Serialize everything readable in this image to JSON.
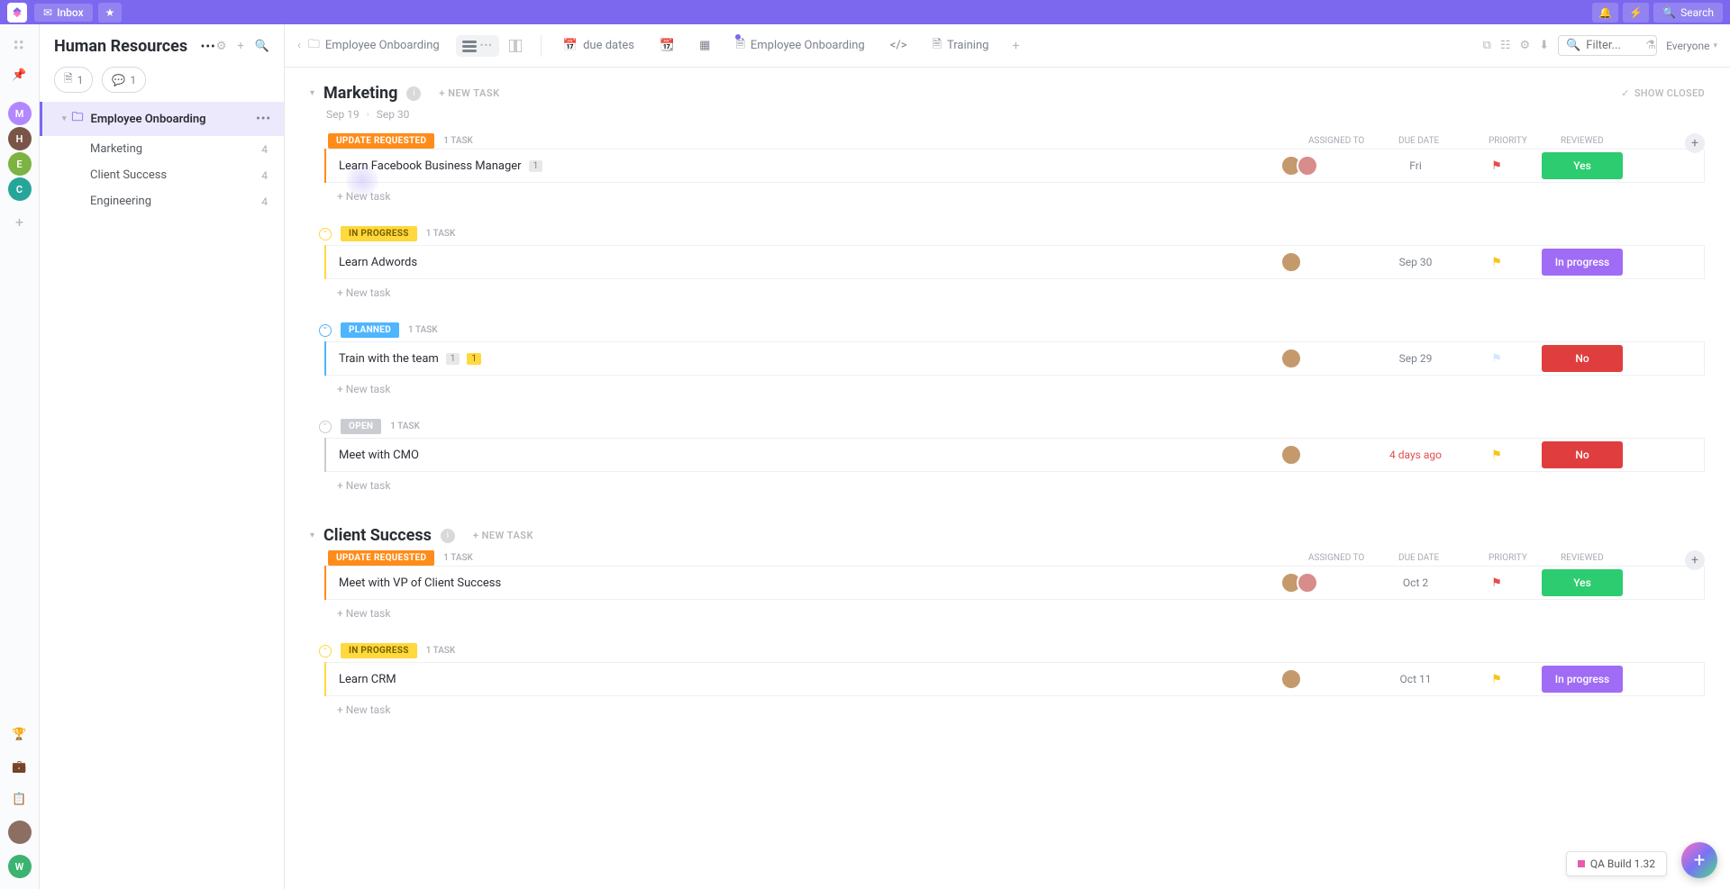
{
  "topbar": {
    "inbox": "Inbox",
    "search": "Search"
  },
  "rail": {
    "spaces": [
      {
        "letter": "M",
        "color": "#b388ff"
      },
      {
        "letter": "H",
        "color": "#795548"
      },
      {
        "letter": "E",
        "color": "#7cb342"
      },
      {
        "letter": "C",
        "color": "#26a69a"
      }
    ]
  },
  "sidebar": {
    "title": "Human Resources",
    "doc_count": "1",
    "comment_count": "1",
    "active_item": "Employee Onboarding",
    "subitems": [
      {
        "label": "Marketing",
        "count": "4"
      },
      {
        "label": "Client Success",
        "count": "4"
      },
      {
        "label": "Engineering",
        "count": "4"
      }
    ]
  },
  "toolbar": {
    "crumb": "Employee Onboarding",
    "due_dates": "due dates",
    "tabs": [
      {
        "label": "Employee Onboarding",
        "dot": true
      },
      {
        "label": "Training",
        "dot": false
      }
    ],
    "filter_placeholder": "Filter...",
    "everyone": "Everyone"
  },
  "columns": {
    "assigned": "ASSIGNED TO",
    "due": "DUE DATE",
    "priority": "PRIORITY",
    "reviewed": "REVIEWED"
  },
  "labels": {
    "new_task_caps": "+ NEW TASK",
    "new_task": "+ New task",
    "show_closed": "SHOW CLOSED",
    "one_task": "1 TASK"
  },
  "status_colors": {
    "update_requested": "#ff8c1a",
    "in_progress": "#ffd93d",
    "planned": "#4fb5ff",
    "open": "#c9ccd1"
  },
  "reviewed_colors": {
    "yes": "#2ecc71",
    "no": "#e03e3e",
    "in_progress": "#a06cf5"
  },
  "flag_colors": {
    "red": "#e84b4b",
    "yellow": "#f5c518",
    "light": "#cfe8ff"
  },
  "groups": [
    {
      "name": "Marketing",
      "start": "Sep 19",
      "end": "Sep 30",
      "show_closed_visible": true,
      "statuses": [
        {
          "name": "UPDATE REQUESTED",
          "color_key": "update_requested",
          "tasks": [
            {
              "title": "Learn Facebook Business Manager",
              "badges": [
                {
                  "text": "1",
                  "cls": ""
                }
              ],
              "avatars": [
                "#c49a6c",
                "#d98c8c"
              ],
              "due": "Fri",
              "overdue": false,
              "flag": "red",
              "reviewed": "Yes",
              "reviewed_key": "yes"
            }
          ]
        },
        {
          "name": "IN PROGRESS",
          "color_key": "in_progress",
          "tasks": [
            {
              "title": "Learn Adwords",
              "badges": [],
              "avatars": [
                "#c49a6c"
              ],
              "due": "Sep 30",
              "overdue": false,
              "flag": "yellow",
              "reviewed": "In progress",
              "reviewed_key": "in_progress"
            }
          ]
        },
        {
          "name": "PLANNED",
          "color_key": "planned",
          "tasks": [
            {
              "title": "Train with the team",
              "badges": [
                {
                  "text": "1",
                  "cls": ""
                },
                {
                  "text": "1",
                  "cls": "yellow"
                }
              ],
              "avatars": [
                "#c49a6c"
              ],
              "due": "Sep 29",
              "overdue": false,
              "flag": "light",
              "reviewed": "No",
              "reviewed_key": "no"
            }
          ]
        },
        {
          "name": "OPEN",
          "color_key": "open",
          "tasks": [
            {
              "title": "Meet with CMO",
              "badges": [],
              "avatars": [
                "#c49a6c"
              ],
              "due": "4 days ago",
              "overdue": true,
              "flag": "yellow",
              "reviewed": "No",
              "reviewed_key": "no"
            }
          ]
        }
      ]
    },
    {
      "name": "Client Success",
      "start": "",
      "end": "",
      "show_closed_visible": false,
      "statuses": [
        {
          "name": "UPDATE REQUESTED",
          "color_key": "update_requested",
          "tasks": [
            {
              "title": "Meet with VP of Client Success",
              "badges": [],
              "avatars": [
                "#c49a6c",
                "#d98c8c"
              ],
              "due": "Oct 2",
              "overdue": false,
              "flag": "red",
              "reviewed": "Yes",
              "reviewed_key": "yes"
            }
          ]
        },
        {
          "name": "IN PROGRESS",
          "color_key": "in_progress",
          "tasks": [
            {
              "title": "Learn CRM",
              "badges": [],
              "avatars": [
                "#c49a6c"
              ],
              "due": "Oct 11",
              "overdue": false,
              "flag": "yellow",
              "reviewed": "In progress",
              "reviewed_key": "in_progress"
            }
          ]
        }
      ]
    }
  ],
  "float": {
    "build": "QA Build 1.32"
  }
}
